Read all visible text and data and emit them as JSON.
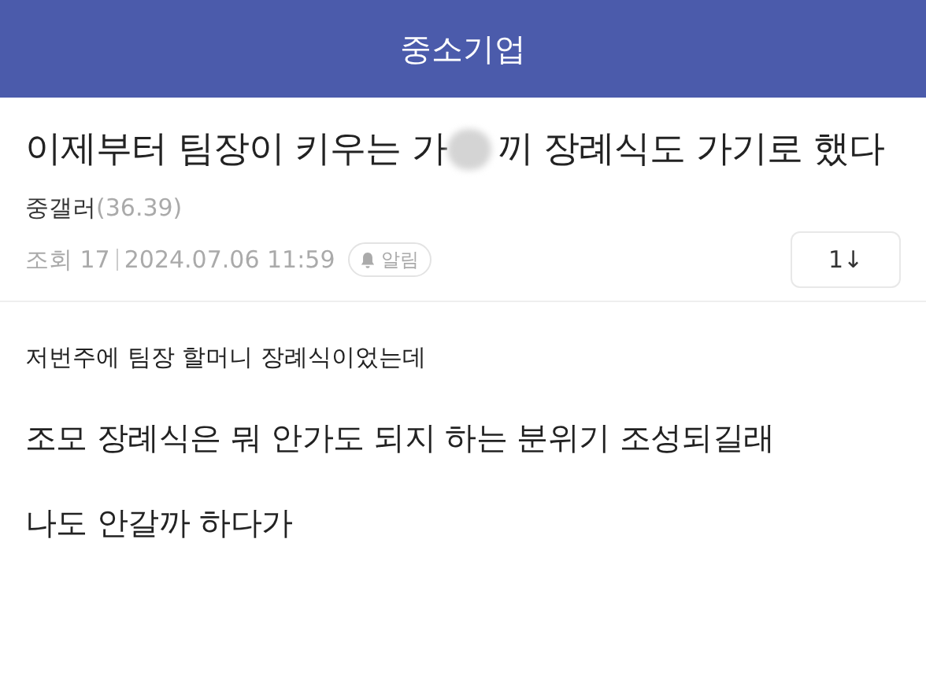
{
  "header": {
    "title": "중소기업"
  },
  "post": {
    "title_before": "이제부터 팀장이 키우는 가",
    "title_after": "끼 장례식도 가기로 했다",
    "author": "중갤러",
    "author_score": "(36.39)",
    "views": "조회 17",
    "date": "2024.07.06 11:59",
    "alert_label": "알림",
    "sort_button": "1↓"
  },
  "body": [
    {
      "text": "저번주에 팀장 할머니 장례식이었는데",
      "kind": "small"
    },
    {
      "text": "조모 장례식은 뭐 안가도 되지 하는 분위기 조성되길래",
      "kind": "large"
    },
    {
      "text": "나도 안갈까 하다가",
      "kind": "large"
    }
  ]
}
